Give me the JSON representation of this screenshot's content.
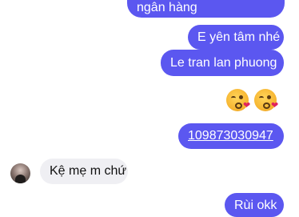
{
  "messages": {
    "outgoing": [
      {
        "text": "ngân hàng"
      },
      {
        "text": "E yên tâm nhé"
      },
      {
        "text": "Le tran lan phuong"
      },
      {
        "text": "109873030947"
      },
      {
        "text": "Rùi okk"
      }
    ],
    "emojis": [
      {
        "icon": "kissing-face-with-heart-emoji"
      },
      {
        "icon": "kissing-face-with-heart-emoji"
      }
    ],
    "incoming": [
      {
        "text": "Kệ mẹ m chứ",
        "avatar_icon": "contact-avatar"
      }
    ]
  },
  "colors": {
    "outgoing_bubble": "#5b57f0",
    "incoming_bubble": "#efeff3",
    "background": "#ffffff"
  }
}
